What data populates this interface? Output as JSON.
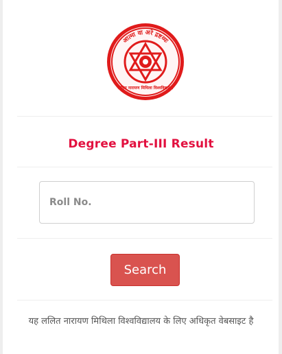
{
  "logo": {
    "arc_text": "आत्मा वा अरे द्रष्टव्यः",
    "bottom_text": "ललित नारायण मिथिला विश्वविद्यालय",
    "color": "#e01b1b"
  },
  "result": {
    "title": "Degree Part-III Result"
  },
  "form": {
    "roll_placeholder": "Roll No.",
    "roll_value": "",
    "search_label": "Search"
  },
  "footer": {
    "text": "यह ललित नारायण मिथिला विश्वविद्यालय के लिए अधिकृत वेबसाइट है"
  },
  "colors": {
    "title": "#e2103f",
    "button": "#d9534f",
    "button_text": "#ffffff"
  }
}
